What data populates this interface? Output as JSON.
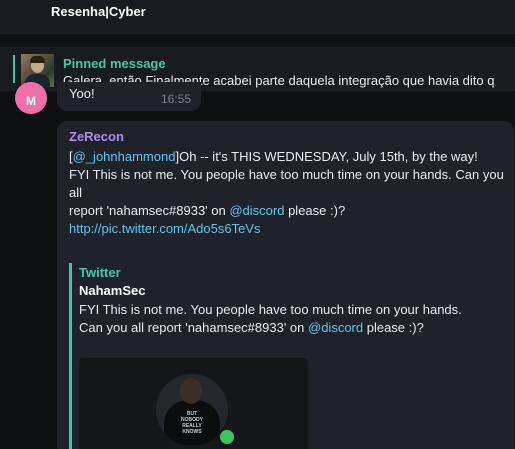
{
  "header": {
    "title": "Resenha|Cyber"
  },
  "pinned": {
    "title": "Pinned message",
    "text": "Galera, então Finalmente acabei parte daquela integração que havia dito q"
  },
  "previous_message": {
    "avatar_initial": "M",
    "text": "Yoo!",
    "time": "16:55"
  },
  "message": {
    "author": "ZeRecon",
    "mention": "@_johnhammond",
    "text_1": "Oh -- it's THIS WEDNESDAY, July 15th, by the way!",
    "text_2": "FYI This is not me. You people have too much time on your hands. Can you all",
    "text_3": "report 'nahamsec#8933' on ",
    "mention_discord": "@discord",
    "text_4": " please :)?",
    "link": "http://pic.twitter.com/Ado5s6TeVs"
  },
  "preview": {
    "site": "Twitter",
    "author": "NahamSec",
    "desc_1": "FYI This is not me. You people have too much time on your hands. Can you all report 'nahamsec#8933' on ",
    "desc_mention": "@discord",
    "desc_2": " please :)?",
    "image_text": "BUT NOBODY REALLY KNOWS"
  },
  "colors": {
    "accent_green": "#45c7a6",
    "author_purple": "#b38af3",
    "link_blue": "#5fc6ee",
    "online_green": "#3fc55e"
  }
}
